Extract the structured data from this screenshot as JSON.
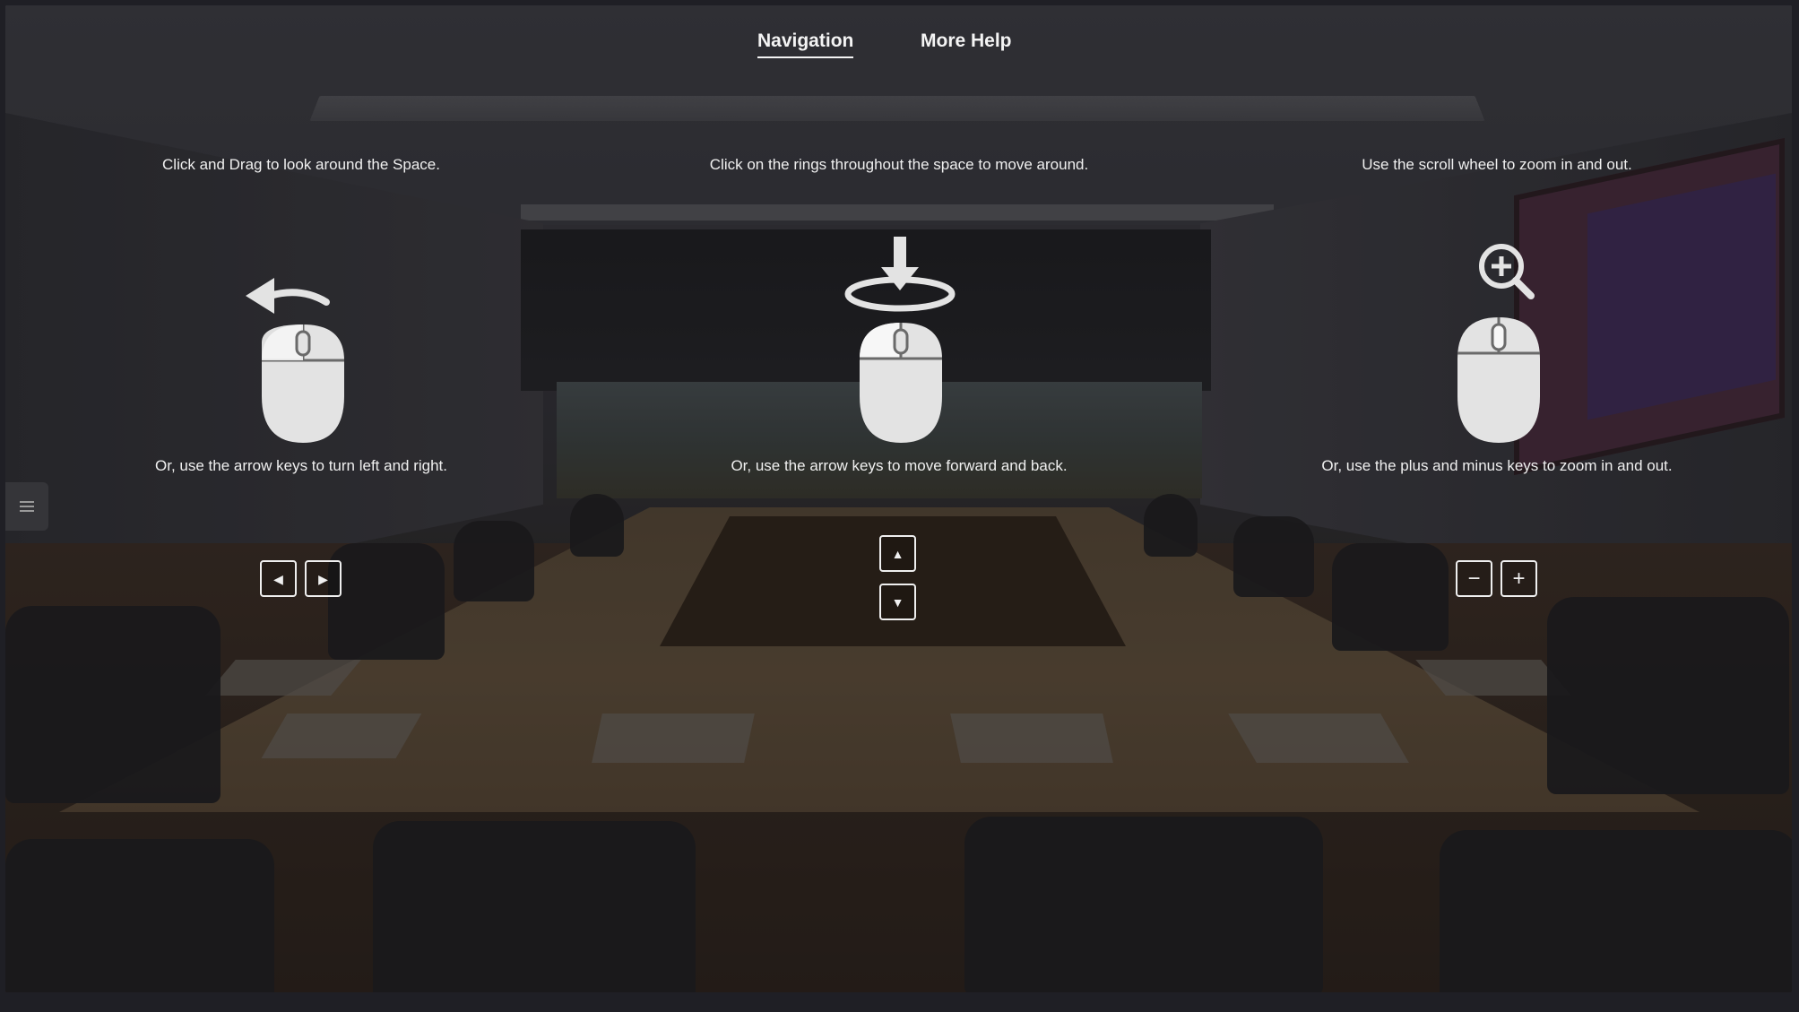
{
  "tabs": {
    "navigation": "Navigation",
    "more_help": "More Help"
  },
  "columns": {
    "look": {
      "top_text": "Click and Drag to look around the Space.",
      "bottom_text": "Or, use the arrow keys to turn left and right.",
      "icon": "mouse-drag-icon",
      "keys": [
        "◀",
        "▶"
      ]
    },
    "move": {
      "top_text": "Click on the rings throughout the space to move around.",
      "bottom_text": "Or, use the arrow keys to move forward and back.",
      "icon": "mouse-click-ring-icon",
      "keys": [
        "▲",
        "▼"
      ]
    },
    "zoom": {
      "top_text": "Use the scroll wheel to zoom in and out.",
      "bottom_text": "Or, use the plus and minus keys to zoom in and out.",
      "icon": "mouse-scroll-zoom-icon",
      "keys": [
        "−",
        "+"
      ]
    }
  },
  "colors": {
    "overlay_text": "#f0f0f0",
    "icon_fill": "#e3e3e3",
    "background": "#1f1f25"
  }
}
